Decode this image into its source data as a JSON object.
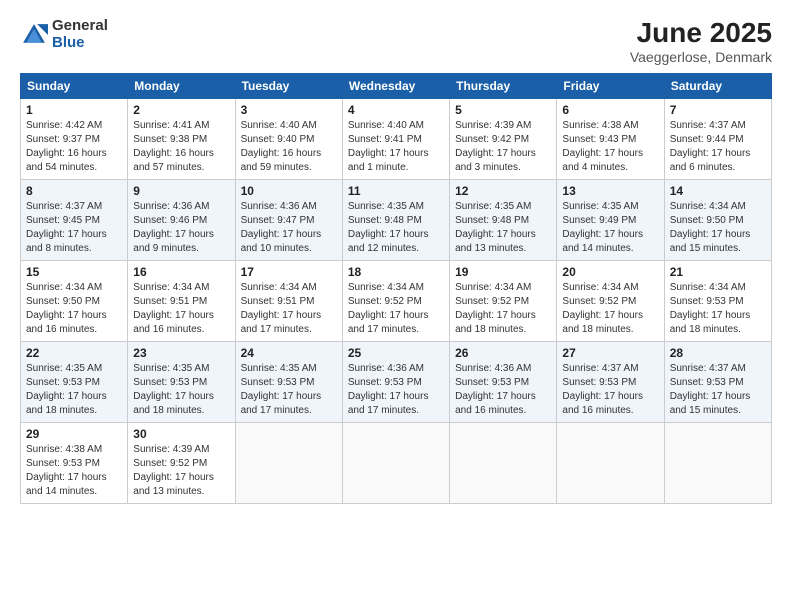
{
  "logo": {
    "general": "General",
    "blue": "Blue"
  },
  "title": "June 2025",
  "location": "Vaeggerlose, Denmark",
  "days_header": [
    "Sunday",
    "Monday",
    "Tuesday",
    "Wednesday",
    "Thursday",
    "Friday",
    "Saturday"
  ],
  "weeks": [
    [
      {
        "day": "1",
        "info": "Sunrise: 4:42 AM\nSunset: 9:37 PM\nDaylight: 16 hours\nand 54 minutes."
      },
      {
        "day": "2",
        "info": "Sunrise: 4:41 AM\nSunset: 9:38 PM\nDaylight: 16 hours\nand 57 minutes."
      },
      {
        "day": "3",
        "info": "Sunrise: 4:40 AM\nSunset: 9:40 PM\nDaylight: 16 hours\nand 59 minutes."
      },
      {
        "day": "4",
        "info": "Sunrise: 4:40 AM\nSunset: 9:41 PM\nDaylight: 17 hours\nand 1 minute."
      },
      {
        "day": "5",
        "info": "Sunrise: 4:39 AM\nSunset: 9:42 PM\nDaylight: 17 hours\nand 3 minutes."
      },
      {
        "day": "6",
        "info": "Sunrise: 4:38 AM\nSunset: 9:43 PM\nDaylight: 17 hours\nand 4 minutes."
      },
      {
        "day": "7",
        "info": "Sunrise: 4:37 AM\nSunset: 9:44 PM\nDaylight: 17 hours\nand 6 minutes."
      }
    ],
    [
      {
        "day": "8",
        "info": "Sunrise: 4:37 AM\nSunset: 9:45 PM\nDaylight: 17 hours\nand 8 minutes."
      },
      {
        "day": "9",
        "info": "Sunrise: 4:36 AM\nSunset: 9:46 PM\nDaylight: 17 hours\nand 9 minutes."
      },
      {
        "day": "10",
        "info": "Sunrise: 4:36 AM\nSunset: 9:47 PM\nDaylight: 17 hours\nand 10 minutes."
      },
      {
        "day": "11",
        "info": "Sunrise: 4:35 AM\nSunset: 9:48 PM\nDaylight: 17 hours\nand 12 minutes."
      },
      {
        "day": "12",
        "info": "Sunrise: 4:35 AM\nSunset: 9:48 PM\nDaylight: 17 hours\nand 13 minutes."
      },
      {
        "day": "13",
        "info": "Sunrise: 4:35 AM\nSunset: 9:49 PM\nDaylight: 17 hours\nand 14 minutes."
      },
      {
        "day": "14",
        "info": "Sunrise: 4:34 AM\nSunset: 9:50 PM\nDaylight: 17 hours\nand 15 minutes."
      }
    ],
    [
      {
        "day": "15",
        "info": "Sunrise: 4:34 AM\nSunset: 9:50 PM\nDaylight: 17 hours\nand 16 minutes."
      },
      {
        "day": "16",
        "info": "Sunrise: 4:34 AM\nSunset: 9:51 PM\nDaylight: 17 hours\nand 16 minutes."
      },
      {
        "day": "17",
        "info": "Sunrise: 4:34 AM\nSunset: 9:51 PM\nDaylight: 17 hours\nand 17 minutes."
      },
      {
        "day": "18",
        "info": "Sunrise: 4:34 AM\nSunset: 9:52 PM\nDaylight: 17 hours\nand 17 minutes."
      },
      {
        "day": "19",
        "info": "Sunrise: 4:34 AM\nSunset: 9:52 PM\nDaylight: 17 hours\nand 18 minutes."
      },
      {
        "day": "20",
        "info": "Sunrise: 4:34 AM\nSunset: 9:52 PM\nDaylight: 17 hours\nand 18 minutes."
      },
      {
        "day": "21",
        "info": "Sunrise: 4:34 AM\nSunset: 9:53 PM\nDaylight: 17 hours\nand 18 minutes."
      }
    ],
    [
      {
        "day": "22",
        "info": "Sunrise: 4:35 AM\nSunset: 9:53 PM\nDaylight: 17 hours\nand 18 minutes."
      },
      {
        "day": "23",
        "info": "Sunrise: 4:35 AM\nSunset: 9:53 PM\nDaylight: 17 hours\nand 18 minutes."
      },
      {
        "day": "24",
        "info": "Sunrise: 4:35 AM\nSunset: 9:53 PM\nDaylight: 17 hours\nand 17 minutes."
      },
      {
        "day": "25",
        "info": "Sunrise: 4:36 AM\nSunset: 9:53 PM\nDaylight: 17 hours\nand 17 minutes."
      },
      {
        "day": "26",
        "info": "Sunrise: 4:36 AM\nSunset: 9:53 PM\nDaylight: 17 hours\nand 16 minutes."
      },
      {
        "day": "27",
        "info": "Sunrise: 4:37 AM\nSunset: 9:53 PM\nDaylight: 17 hours\nand 16 minutes."
      },
      {
        "day": "28",
        "info": "Sunrise: 4:37 AM\nSunset: 9:53 PM\nDaylight: 17 hours\nand 15 minutes."
      }
    ],
    [
      {
        "day": "29",
        "info": "Sunrise: 4:38 AM\nSunset: 9:53 PM\nDaylight: 17 hours\nand 14 minutes."
      },
      {
        "day": "30",
        "info": "Sunrise: 4:39 AM\nSunset: 9:52 PM\nDaylight: 17 hours\nand 13 minutes."
      },
      {
        "day": "",
        "info": ""
      },
      {
        "day": "",
        "info": ""
      },
      {
        "day": "",
        "info": ""
      },
      {
        "day": "",
        "info": ""
      },
      {
        "day": "",
        "info": ""
      }
    ]
  ]
}
